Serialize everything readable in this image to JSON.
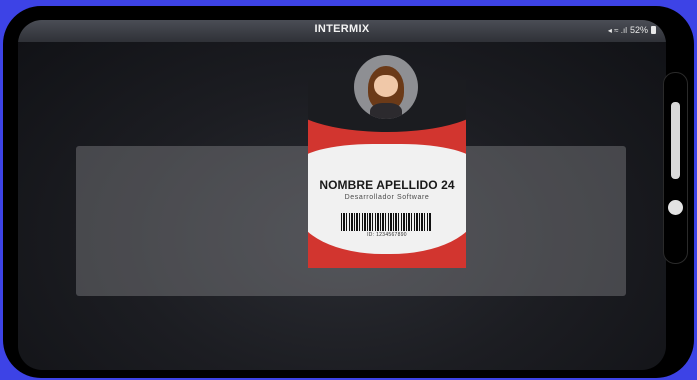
{
  "status_bar": {
    "title": "INTERMIX",
    "signal_text": "◂ ≈ .ıl",
    "battery": "52%"
  },
  "id_card": {
    "name": "NOMBRE APELLIDO 24",
    "role": "Desarrollador Software",
    "id_number": "ID: 1234567890"
  },
  "colors": {
    "background_accent": "#3d43e6",
    "card_red": "#d2352f",
    "card_dark": "#1b1c20"
  },
  "icons": [
    "avatar-illustration",
    "barcode",
    "wifi-icon",
    "signal-icon",
    "battery-icon"
  ]
}
